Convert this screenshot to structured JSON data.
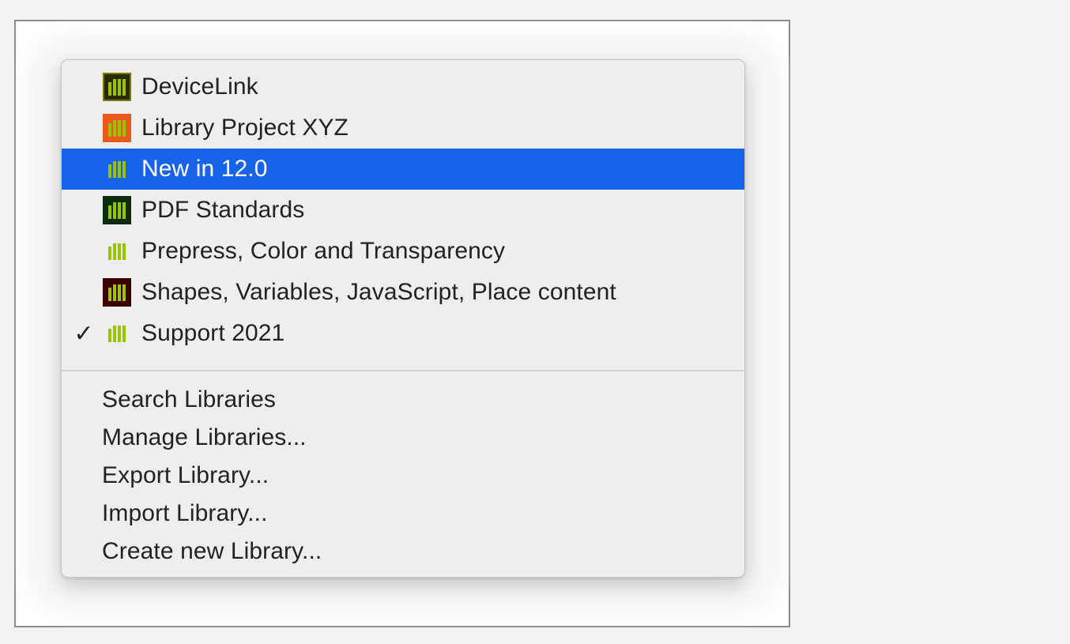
{
  "menu": {
    "libraries": [
      {
        "label": "DeviceLink",
        "icon": "library-icon",
        "icon_bg": "#2b2b00",
        "icon_border": "#7a7a00",
        "selected": false,
        "checked": false
      },
      {
        "label": "Library Project XYZ",
        "icon": "library-icon",
        "icon_bg": "#ea5a1d",
        "icon_border": "#ea5a1d",
        "selected": false,
        "checked": false
      },
      {
        "label": "New in 12.0",
        "icon": "library-icon",
        "icon_bg": "transparent",
        "icon_border": "transparent",
        "selected": true,
        "checked": false
      },
      {
        "label": "PDF Standards",
        "icon": "library-icon",
        "icon_bg": "#0c2c0c",
        "icon_border": "#0c2c0c",
        "selected": false,
        "checked": false
      },
      {
        "label": "Prepress, Color and Transparency",
        "icon": "library-icon",
        "icon_bg": "transparent",
        "icon_border": "transparent",
        "selected": false,
        "checked": false
      },
      {
        "label": "Shapes, Variables, JavaScript, Place content",
        "icon": "library-icon",
        "icon_bg": "#3a0000",
        "icon_border": "#3a0000",
        "selected": false,
        "checked": false
      },
      {
        "label": "Support 2021",
        "icon": "library-icon",
        "icon_bg": "transparent",
        "icon_border": "transparent",
        "selected": false,
        "checked": true,
        "check_glyph": "✓"
      }
    ],
    "commands": [
      {
        "label": "Search Libraries"
      },
      {
        "label": "Manage Libraries..."
      },
      {
        "label": "Export Library..."
      },
      {
        "label": "Import Library..."
      },
      {
        "label": "Create new Library..."
      }
    ]
  },
  "colors": {
    "selection": "#1763ea",
    "bar_green": "#9ac400"
  }
}
